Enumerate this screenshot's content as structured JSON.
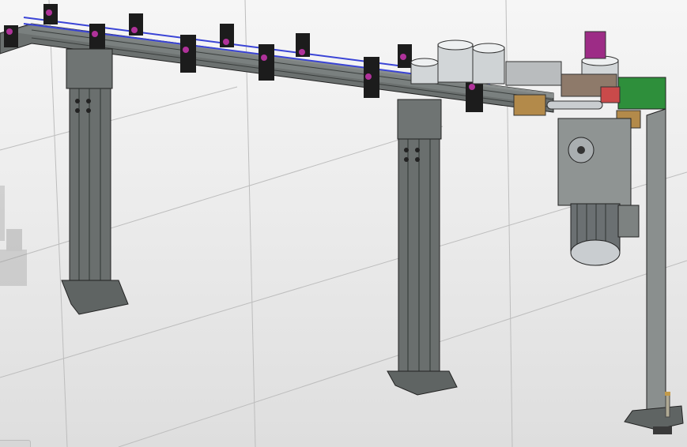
{
  "viewport": {
    "background_top": "#f6f6f6",
    "background_bottom": "#dedede",
    "grid_color": "#b9b9b9"
  },
  "model": {
    "frame_color": "#6f7473",
    "frame_dark": "#2f3433",
    "bracket_color": "#1c1c1c",
    "bolt_color": "#b0329a",
    "rail_color": "#3a44d6",
    "motor_color": "#c9cdd0",
    "plate_color": "#b38a4a",
    "accent_green": "#2e8f3b",
    "accent_red": "#c94a4a"
  }
}
